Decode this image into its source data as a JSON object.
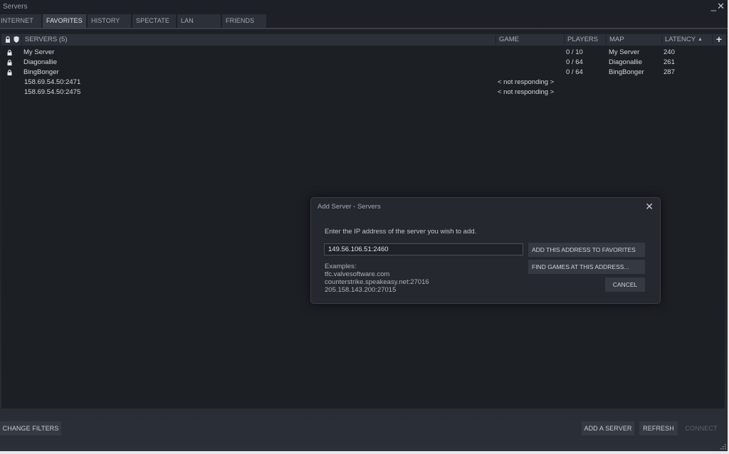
{
  "window": {
    "title": "Servers",
    "minimize_glyph": "_",
    "close_glyph": "✕"
  },
  "tabs": [
    {
      "label": "INTERNET",
      "active": false
    },
    {
      "label": "FAVORITES",
      "active": true
    },
    {
      "label": "HISTORY",
      "active": false
    },
    {
      "label": "SPECTATE",
      "active": false
    },
    {
      "label": "LAN",
      "active": false
    },
    {
      "label": "FRIENDS",
      "active": false
    }
  ],
  "table": {
    "header_icons": [
      "lock-icon",
      "shield-icon"
    ],
    "columns": {
      "servers": "SERVERS (5)",
      "game": "GAME",
      "players": "PLAYERS",
      "map": "MAP",
      "latency": "LATENCY",
      "sort_indicator": "▲",
      "add_column": "+"
    },
    "rows": [
      {
        "locked": true,
        "name": "My Server",
        "game": "",
        "players": "0 / 10",
        "map": "My Server",
        "latency": "240"
      },
      {
        "locked": true,
        "name": "Diagonallie",
        "game": "",
        "players": "0 / 64",
        "map": "Diagonallie",
        "latency": "261"
      },
      {
        "locked": true,
        "name": "BingBonger",
        "game": "",
        "players": "0 / 64",
        "map": "BingBonger",
        "latency": "287"
      },
      {
        "locked": false,
        "name": "158.69.54.50:2471",
        "game": "< not responding >",
        "players": "",
        "map": "",
        "latency": ""
      },
      {
        "locked": false,
        "name": "158.69.54.50:2475",
        "game": "< not responding >",
        "players": "",
        "map": "",
        "latency": ""
      }
    ]
  },
  "footer": {
    "change_filters": "CHANGE FILTERS",
    "add_server": "ADD A SERVER",
    "refresh": "REFRESH",
    "connect": "CONNECT"
  },
  "dialog": {
    "title": "Add Server - Servers",
    "close_glyph": "✕",
    "prompt": "Enter the IP address of the server you wish to add.",
    "address_value": "149.56.106.51:2460",
    "examples_label": "Examples:",
    "examples": [
      "tfc.valvesoftware.com",
      "counterstrike.speakeasy.net:27016",
      "205.158.143.200:27015"
    ],
    "add_favorites": "ADD THIS ADDRESS TO FAVORITES",
    "find_games": "FIND GAMES AT THIS ADDRESS...",
    "cancel": "CANCEL"
  }
}
